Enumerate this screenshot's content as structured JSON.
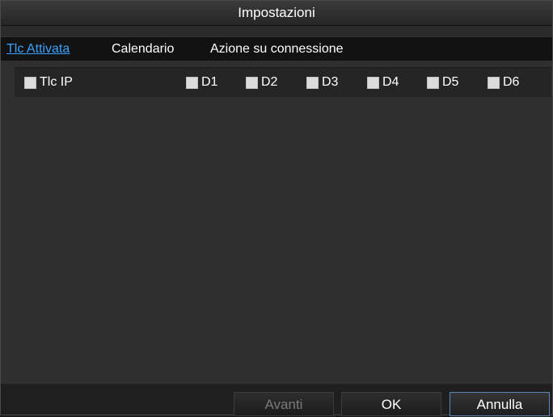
{
  "dialog": {
    "title": "Impostazioni"
  },
  "tabs": [
    {
      "label": "Tlc Attivata",
      "active": true
    },
    {
      "label": "Calendario",
      "active": false
    },
    {
      "label": "Azione su connessione",
      "active": false
    }
  ],
  "checkboxes": {
    "main": {
      "label": "Tlc IP",
      "checked": false
    },
    "items": [
      {
        "label": "D1",
        "checked": false
      },
      {
        "label": "D2",
        "checked": false
      },
      {
        "label": "D3",
        "checked": false
      },
      {
        "label": "D4",
        "checked": false
      },
      {
        "label": "D5",
        "checked": false
      },
      {
        "label": "D6",
        "checked": false
      }
    ]
  },
  "buttons": {
    "next": {
      "label": "Avanti",
      "enabled": false
    },
    "ok": {
      "label": "OK",
      "enabled": true
    },
    "cancel": {
      "label": "Annulla",
      "enabled": true
    }
  },
  "colors": {
    "active_tab": "#3aa3ff",
    "panel_bg": "#2f2f2f"
  }
}
